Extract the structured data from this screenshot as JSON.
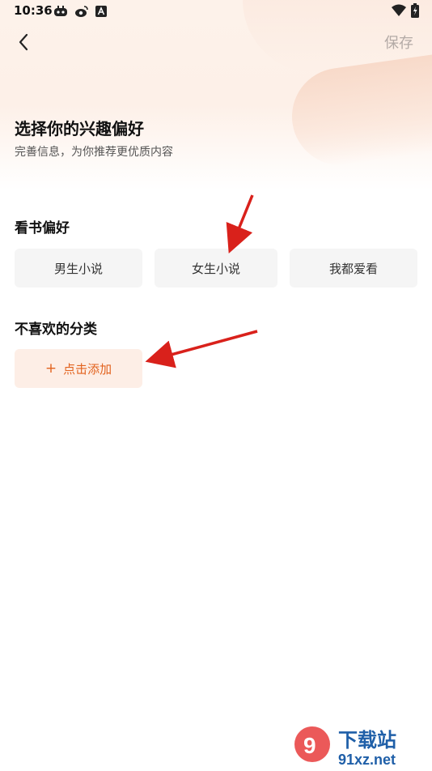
{
  "status_bar": {
    "time": "10:36",
    "icons": [
      "game-controller-icon",
      "weibo-icon",
      "a-badge-icon",
      "wifi-icon",
      "battery-charging-icon"
    ]
  },
  "nav": {
    "back_icon": "chevron-left-icon",
    "save_label": "保存"
  },
  "header": {
    "title": "选择你的兴趣偏好",
    "subtitle": "完善信息，为你推荐更优质内容"
  },
  "reading_pref": {
    "title": "看书偏好",
    "options": [
      "男生小说",
      "女生小说",
      "我都爱看"
    ]
  },
  "dislike": {
    "title": "不喜欢的分类",
    "add_label": "点击添加",
    "add_icon": "plus-icon"
  },
  "watermark": {
    "brand": "下载站",
    "domain": "91xz.net"
  },
  "colors": {
    "accent": "#e2631f",
    "annotation_arrow": "#d9211b"
  }
}
